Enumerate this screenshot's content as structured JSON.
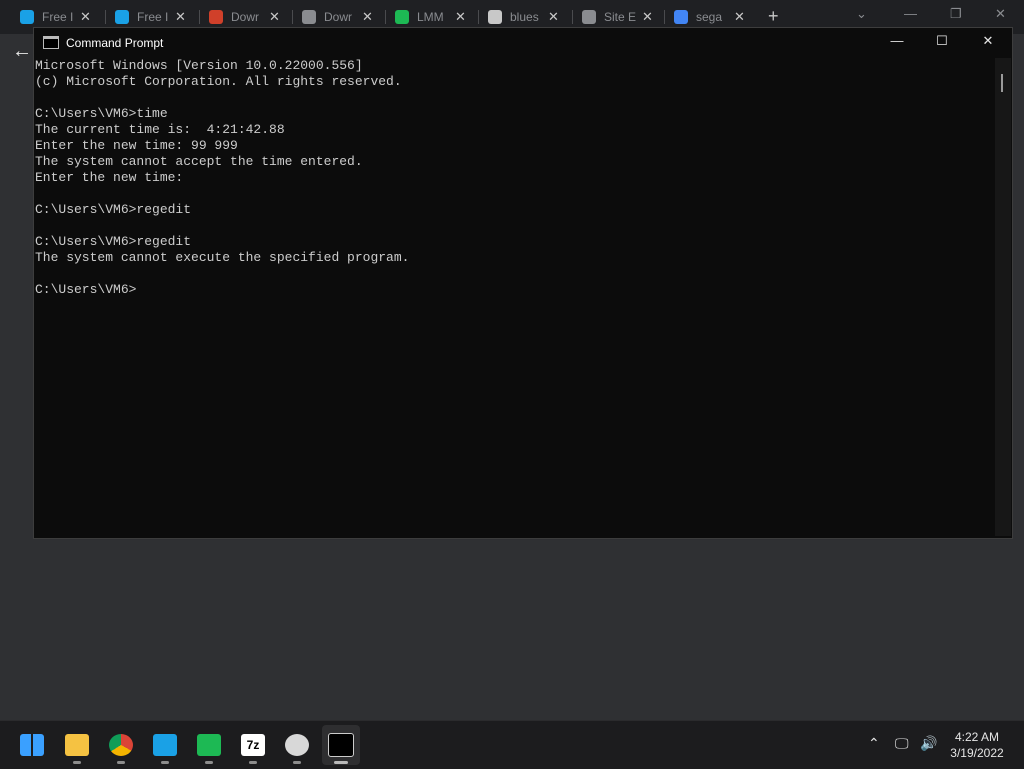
{
  "browser": {
    "tabs": [
      {
        "label": "Free I",
        "icon": "site-icon-blue",
        "color": "#1aa1e6"
      },
      {
        "label": "Free I",
        "icon": "site-icon-blue",
        "color": "#1aa1e6"
      },
      {
        "label": "Dowr",
        "icon": "x-logo-icon",
        "color": "#d0402a"
      },
      {
        "label": "Dowr",
        "icon": "globe-icon",
        "color": "#8a8c90"
      },
      {
        "label": "LMM",
        "icon": "headphones-icon",
        "color": "#1db954"
      },
      {
        "label": "blues",
        "icon": "sad-face-icon",
        "color": "#c8c8c8"
      },
      {
        "label": "Site E",
        "icon": "globe-icon",
        "color": "#8a8c90"
      },
      {
        "label": "sega",
        "icon": "google-icon",
        "color": "#4285f4"
      }
    ],
    "new_tab": "+"
  },
  "cmd": {
    "title": "Command Prompt",
    "minimize": "—",
    "maximize": "☐",
    "close": "✕",
    "lines": [
      "Microsoft Windows [Version 10.0.22000.556]",
      "(c) Microsoft Corporation. All rights reserved.",
      "",
      "C:\\Users\\VM6>time",
      "The current time is:  4:21:42.88",
      "Enter the new time: 99 999",
      "The system cannot accept the time entered.",
      "Enter the new time:",
      "",
      "C:\\Users\\VM6>regedit",
      "",
      "C:\\Users\\VM6>regedit",
      "The system cannot execute the specified program.",
      "",
      "C:\\Users\\VM6>"
    ]
  },
  "taskbar": {
    "apps": [
      {
        "name": "start-button",
        "icon": "windows-logo-icon",
        "glyph": "",
        "color": "#3aa0ff"
      },
      {
        "name": "file-explorer",
        "icon": "folder-icon",
        "glyph": "",
        "color": "#f5c242"
      },
      {
        "name": "chrome",
        "icon": "chrome-icon",
        "glyph": "",
        "color": "#4285f4"
      },
      {
        "name": "app-blue",
        "icon": "site-icon-blue",
        "glyph": "",
        "color": "#1aa1e6"
      },
      {
        "name": "lmms",
        "icon": "headphones-icon",
        "glyph": "",
        "color": "#1db954"
      },
      {
        "name": "7zip",
        "icon": "7zip-icon",
        "glyph": "7z",
        "color": "#ffffff"
      },
      {
        "name": "clock-app",
        "icon": "clock-app-icon",
        "glyph": "",
        "color": "#e6e6e6"
      },
      {
        "name": "command-prompt",
        "icon": "terminal-icon",
        "glyph": "",
        "color": "#e6e6e6"
      }
    ],
    "time": "4:22 AM",
    "date": "3/19/2022"
  }
}
